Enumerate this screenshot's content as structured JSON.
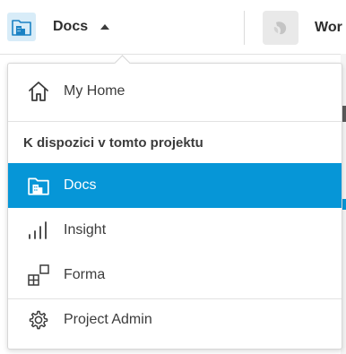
{
  "header": {
    "app_name": "Docs",
    "project_name": "Wor",
    "accent_color": "#0696d7"
  },
  "menu": {
    "home_label": "My Home",
    "section_title": "K dispozici v tomto projektu",
    "items": [
      {
        "label": "Docs",
        "icon": "docs-building-icon",
        "active": true
      },
      {
        "label": "Insight",
        "icon": "bar-chart-icon",
        "active": false
      },
      {
        "label": "Forma",
        "icon": "forma-blocks-icon",
        "active": false
      }
    ],
    "admin_label": "Project Admin"
  }
}
